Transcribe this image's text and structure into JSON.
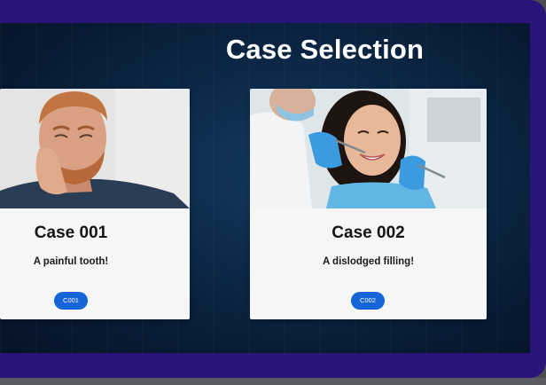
{
  "page": {
    "title": "Case Selection"
  },
  "cases": [
    {
      "title": "Case 001",
      "description": "A painful tooth!",
      "code": "C001",
      "photo_icon": "man-with-toothache-photo"
    },
    {
      "title": "Case 002",
      "description": "A dislodged filling!",
      "code": "C002",
      "photo_icon": "woman-at-dentist-photo"
    }
  ],
  "colors": {
    "frame": "#2a1379",
    "screen_bg": "#0c2848",
    "card_bg": "#f6f6f7",
    "button": "#1565d8"
  }
}
